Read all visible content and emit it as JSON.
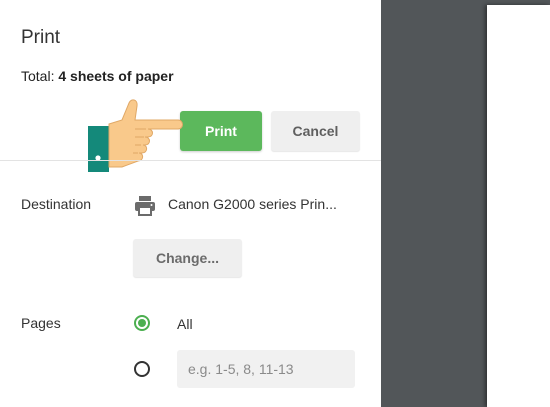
{
  "header": {
    "title": "Print",
    "total_prefix": "Total: ",
    "total_value": "4 sheets of paper"
  },
  "actions": {
    "print_label": "Print",
    "cancel_label": "Cancel"
  },
  "destination": {
    "label": "Destination",
    "printer_name": "Canon G2000 series Prin...",
    "change_label": "Change..."
  },
  "pages": {
    "label": "Pages",
    "options": [
      {
        "label": "All",
        "selected": true
      },
      {
        "label": "",
        "selected": false
      }
    ],
    "custom_placeholder": "e.g. 1-5, 8, 11-13"
  },
  "icons": {
    "printer": "printer-icon",
    "hand": "pointing-hand-icon"
  },
  "colors": {
    "accent_green": "#5cb85c",
    "preview_background": "#525659",
    "hand_cuff": "#14897a",
    "hand_skin": "#f9c98b"
  }
}
